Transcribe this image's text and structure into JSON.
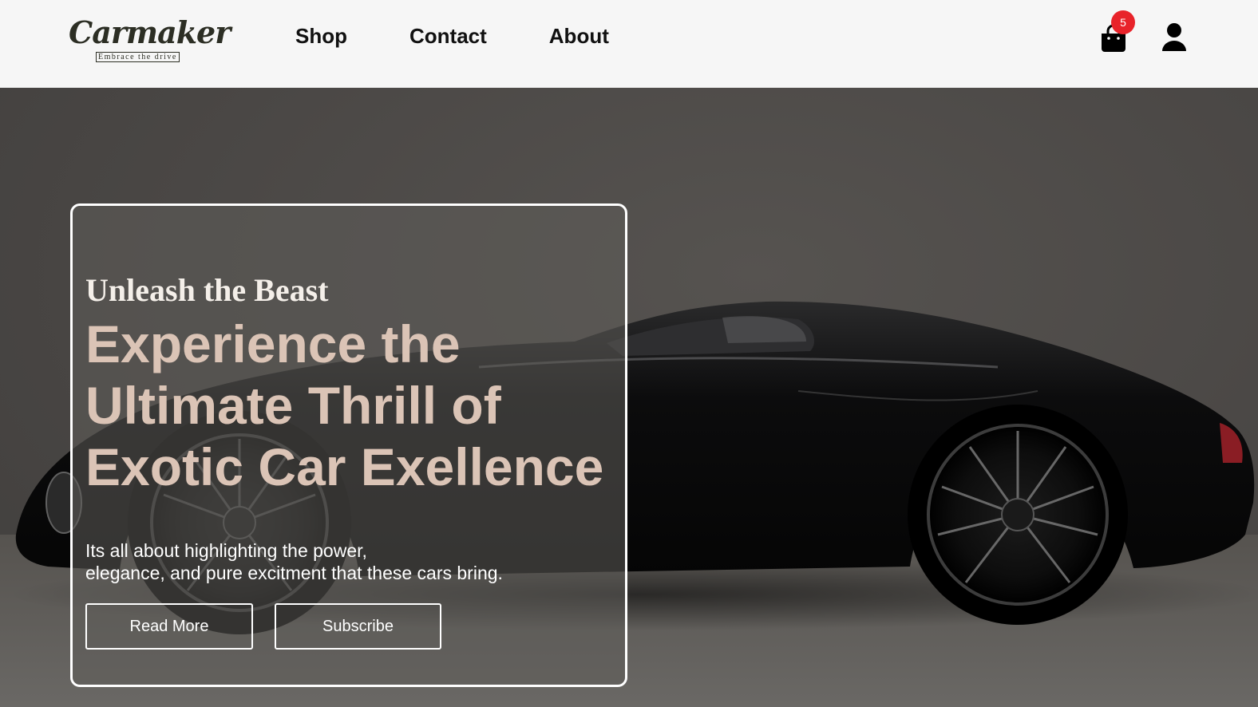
{
  "brand": {
    "name": "Carmaker",
    "tagline": "Embrace the drive"
  },
  "nav": {
    "items": [
      {
        "label": "Shop"
      },
      {
        "label": "Contact"
      },
      {
        "label": "About"
      }
    ]
  },
  "header_actions": {
    "cart_icon": "shopping-bag-icon",
    "cart_count": "5",
    "user_icon": "user-icon",
    "badge_color": "#e8232a"
  },
  "hero": {
    "eyebrow": "Unleash the Beast",
    "headline": "Experience the Ultimate Thrill of Exotic Car Exellence",
    "description_line1": "Its all about highlighting the power,",
    "description_line2": "elegance, and pure excitment that these cars bring.",
    "buttons": {
      "read_more": "Read More",
      "subscribe": "Subscribe"
    },
    "headline_color": "#dbc4b6",
    "background_image": "black exotic sports car"
  }
}
